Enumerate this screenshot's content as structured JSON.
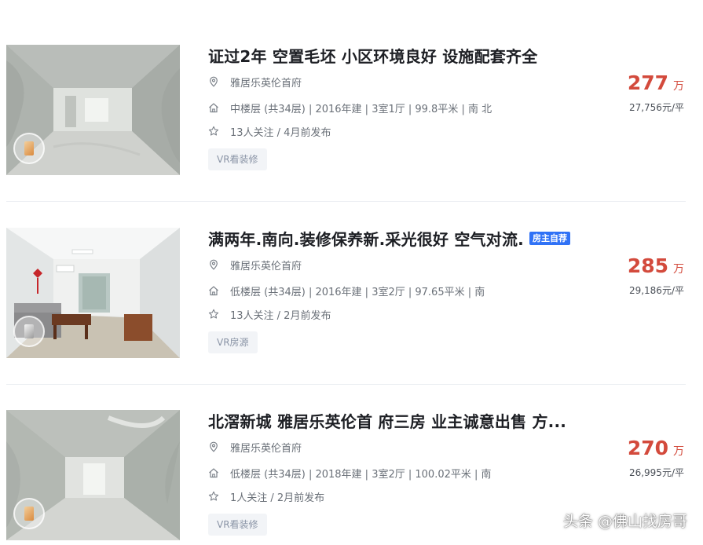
{
  "listings": [
    {
      "title": "证过2年 空置毛坯 小区环境良好 设施配套齐全",
      "tag": "",
      "community": "雅居乐英伦首府",
      "details": "中楼层 (共34层) | 2016年建 | 3室1厅 | 99.8平米 | 南 北",
      "followers": "13人关注 / 4月前发布",
      "vr_label": "VR看装修",
      "price_total": "277",
      "price_unit": "万",
      "price_per": "27,756元/平",
      "image_icon": "vr-360-icon"
    },
    {
      "title": "满两年.南向.装修保养新.采光很好 空气对流.",
      "tag": "房主自荐",
      "community": "雅居乐英伦首府",
      "details": "低楼层 (共34层) | 2016年建 | 3室2厅 | 97.65平米 | 南",
      "followers": "13人关注 / 2月前发布",
      "vr_label": "VR房源",
      "price_total": "285",
      "price_unit": "万",
      "price_per": "29,186元/平",
      "image_icon": "vr-360-icon"
    },
    {
      "title": "北滘新城 雅居乐英伦首 府三房 业主诚意出售 方...",
      "tag": "",
      "community": "雅居乐英伦首府",
      "details": "低楼层 (共34层) | 2018年建 | 3室2厅 | 100.02平米 | 南",
      "followers": "1人关注 / 2月前发布",
      "vr_label": "VR看装修",
      "price_total": "270",
      "price_unit": "万",
      "price_per": "26,995元/平",
      "image_icon": "vr-360-icon"
    }
  ],
  "watermark": "头条 @佛山找房哥",
  "colors": {
    "price": "#d34a3c",
    "tag_bg": "#3072f6",
    "meta_text": "#6a7078"
  }
}
